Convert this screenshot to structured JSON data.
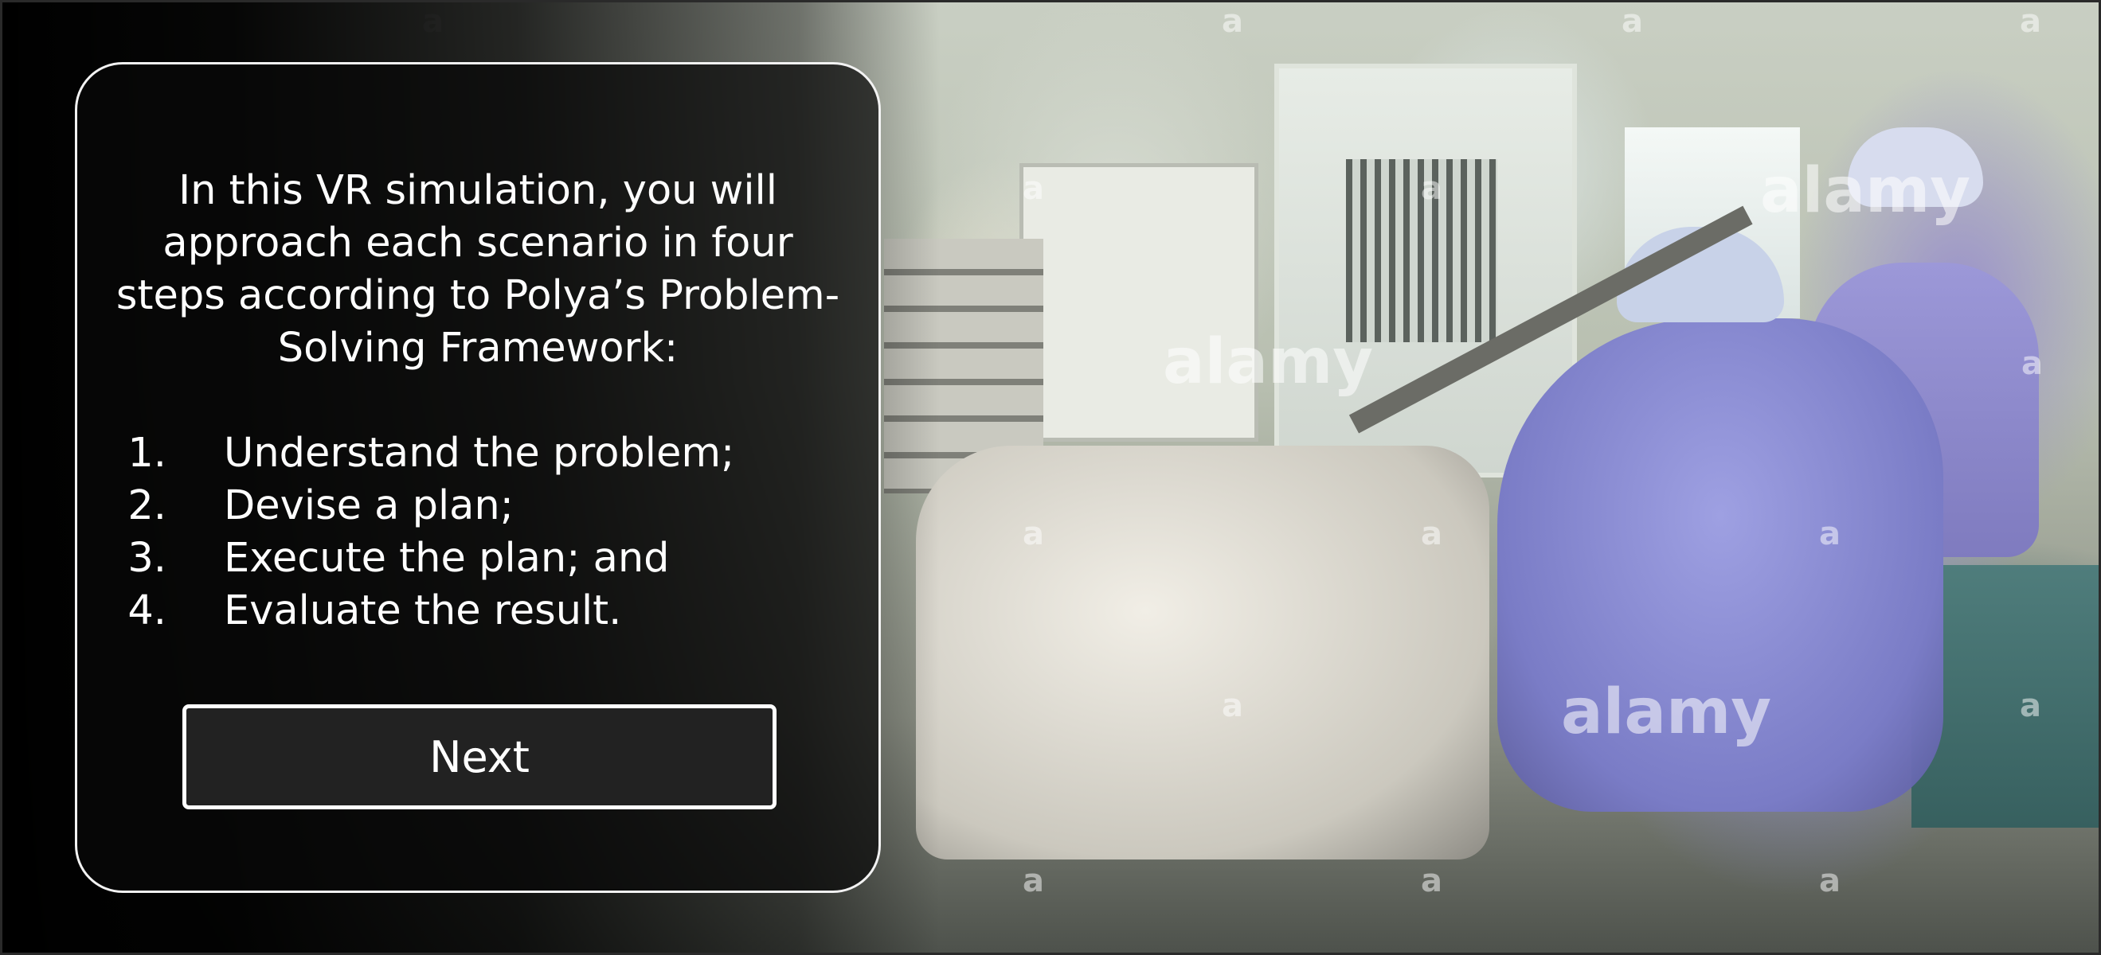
{
  "dialog": {
    "intro_text": "In this VR simulation, you will approach each scenario in four steps according to Polya’s Problem-Solving Framework:",
    "steps": [
      {
        "number": "1.",
        "text": "Understand the problem;"
      },
      {
        "number": "2.",
        "text": "Devise a plan;"
      },
      {
        "number": "3.",
        "text": "Execute the plan; and"
      },
      {
        "number": "4.",
        "text": "Evaluate the result."
      }
    ],
    "next_button_label": "Next"
  },
  "background": {
    "watermark_text": "alamy",
    "watermark_letter": "a"
  },
  "colors": {
    "dialog_border": "#f2f2f2",
    "dialog_text": "#ffffff",
    "button_background": "#222222",
    "button_border": "#ffffff"
  }
}
